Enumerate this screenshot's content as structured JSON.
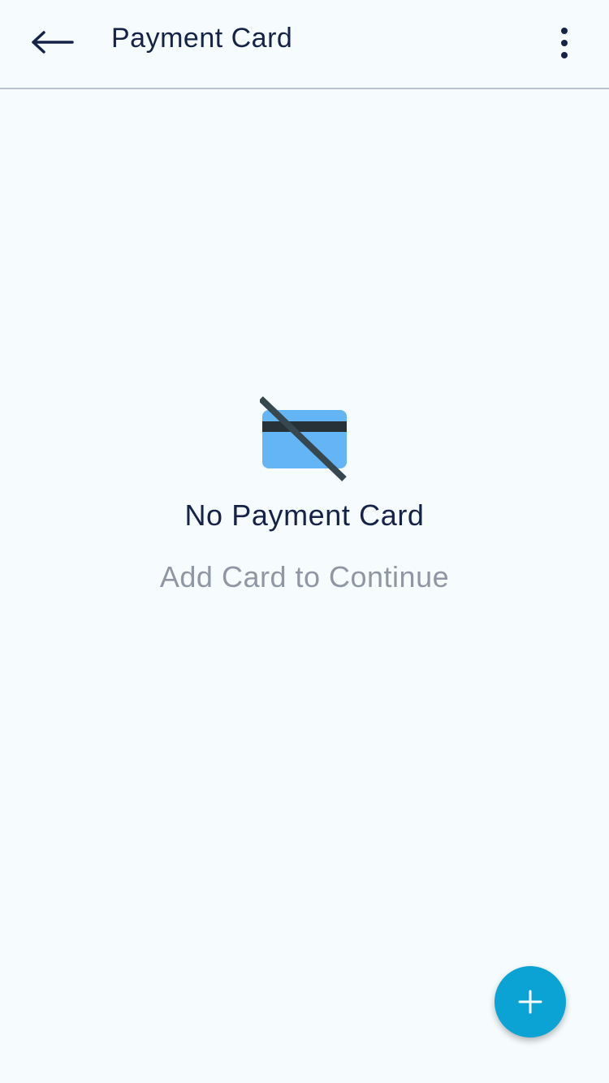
{
  "header": {
    "title": "Payment Card",
    "back_icon": "arrow-left-icon",
    "menu_icon": "more-vertical-icon"
  },
  "empty_state": {
    "icon": "card-off-icon",
    "title": "No Payment Card",
    "subtitle": "Add Card to Continue"
  },
  "fab": {
    "icon": "plus-icon"
  },
  "colors": {
    "background": "#f6fcfd",
    "text_primary": "#152349",
    "text_secondary": "#8f97a5",
    "accent": "#0aa3d4",
    "card_fill": "#64b5f6",
    "card_strike": "#37474f",
    "divider": "#b8c2cc"
  }
}
